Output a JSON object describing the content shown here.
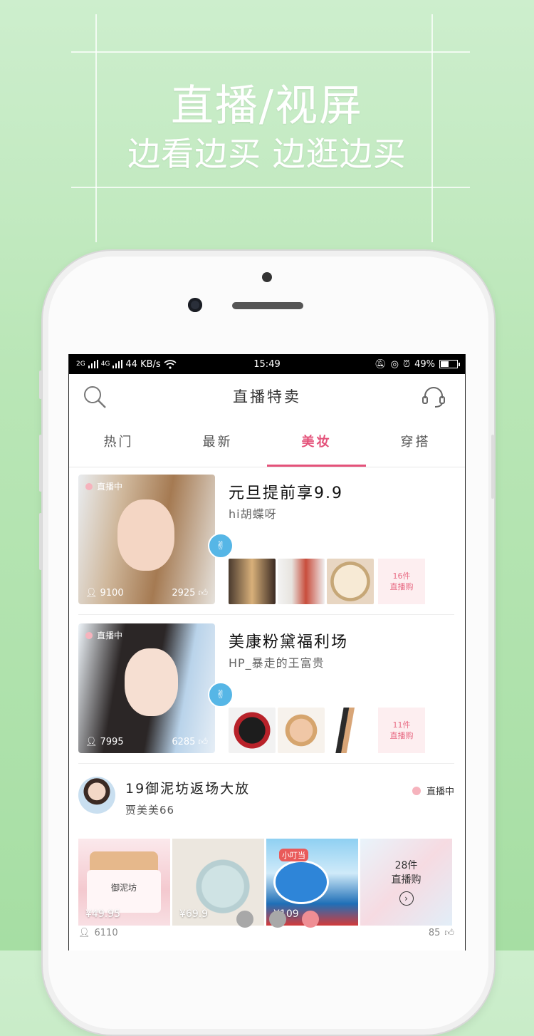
{
  "promo": {
    "headline": "直播/视屏",
    "subline": "边看边买 边逛边买"
  },
  "statusbar": {
    "signal_left": "2G",
    "signal_right": "4G",
    "speed": "44 KB/s",
    "time": "15:49",
    "battery": "49%",
    "battery_level": 0.49
  },
  "appbar": {
    "title": "直播特卖",
    "left_icon": "search-icon",
    "right_icon": "headset-icon"
  },
  "tabs": [
    {
      "label": "热门",
      "active": false
    },
    {
      "label": "最新",
      "active": false
    },
    {
      "label": "美妆",
      "active": true
    },
    {
      "label": "穿搭",
      "active": false
    }
  ],
  "cards": [
    {
      "live": "直播中",
      "viewers": "9100",
      "likes": "2925",
      "title": "元旦提前享9.9",
      "user": "hi胡蝶呀",
      "more_count": "16件",
      "more_label": "直播购"
    },
    {
      "live": "直播中",
      "viewers": "7995",
      "likes": "6285",
      "title": "美康粉黛福利场",
      "user": "HP_暴走的王富贵",
      "more_count": "11件",
      "more_label": "直播购"
    }
  ],
  "shop": {
    "title": "19御泥坊返场大放",
    "user": "贾美美66",
    "live": "直播中",
    "products": [
      {
        "price": "¥49.95",
        "label": "御泥坊"
      },
      {
        "price": "¥69.9"
      },
      {
        "price": "¥109",
        "label": "小叮当"
      }
    ],
    "more_count": "28件",
    "more_label": "直播购",
    "viewers": "6110",
    "likes": "85"
  },
  "colors": {
    "accent": "#e4527a",
    "bg_top": "#cdeecd",
    "bg_bottom": "#a6dea3"
  }
}
